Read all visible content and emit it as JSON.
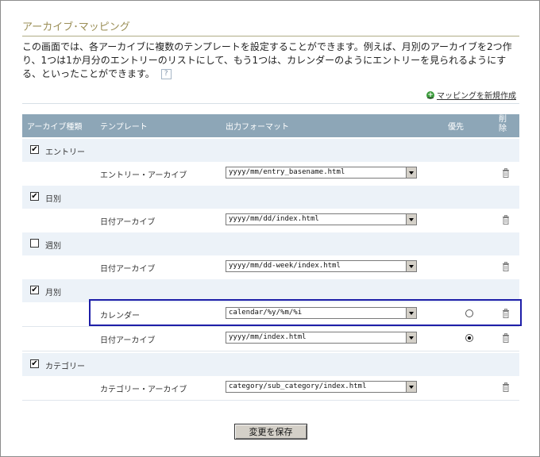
{
  "section": {
    "title": "アーカイブ･マッピング",
    "description": "この画面では、各アーカイブに複数のテンプレートを設定することができます。例えば、月別のアーカイブを2つ作り、1つは1か月分のエントリーのリストにして、もう1つは、カレンダーのようにエントリーを見られるようにする、といったことができます。",
    "help": "?"
  },
  "new_mapping_link": "マッピングを新規作成",
  "columns": {
    "archive_type": "アーカイブ種類",
    "template": "テンプレート",
    "output_format": "出力フォーマット",
    "preferred": "優先",
    "delete": "削\n除"
  },
  "groups": [
    {
      "label": "エントリー",
      "checked": "✔"
    },
    {
      "label": "日別",
      "checked": "✔"
    },
    {
      "label": "週別",
      "checked": ""
    },
    {
      "label": "月別",
      "checked": "✔"
    },
    {
      "label": "カテゴリー",
      "checked": "✔"
    }
  ],
  "rows": [
    {
      "template": "エントリー・アーカイブ",
      "format": "yyyy/mm/entry_basename.html",
      "preferred": null
    },
    {
      "template": "日付アーカイブ",
      "format": "yyyy/mm/dd/index.html",
      "preferred": null
    },
    {
      "template": "日付アーカイブ",
      "format": "yyyy/mm/dd-week/index.html",
      "preferred": null
    },
    {
      "template": "カレンダー",
      "format": "calendar/%y/%m/%i",
      "preferred": false
    },
    {
      "template": "日付アーカイブ",
      "format": "yyyy/mm/index.html",
      "preferred": true
    },
    {
      "template": "カテゴリー・アーカイブ",
      "format": "category/sub_category/index.html",
      "preferred": null
    }
  ],
  "save_button": "変更を保存",
  "icons": {
    "add": "plus-circle-icon",
    "delete": "trash-icon",
    "help": "help-icon"
  },
  "colors": {
    "header_bg": "#8da6b7",
    "group_bg": "#ecf2f8",
    "highlight": "#1e1ea8",
    "title": "#9b8f57"
  }
}
